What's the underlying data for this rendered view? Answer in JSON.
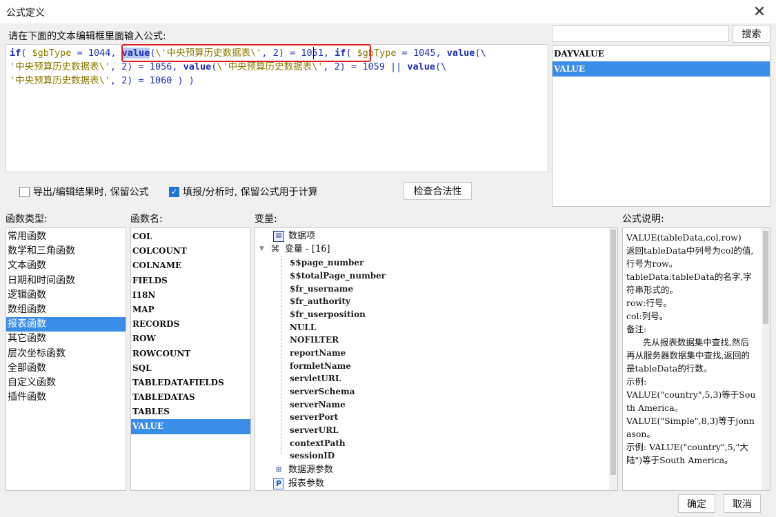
{
  "window": {
    "title": "公式定义",
    "close_icon": "close-icon"
  },
  "editor": {
    "label": "请在下面的文本编辑框里面输入公式:",
    "line1": {
      "if1": "if",
      "p1": "( ",
      "var1": "$gbType",
      "op1": " = ",
      "n1": "1044",
      "p2": ", ",
      "fn1": "value",
      "p3": "(",
      "s1": "\\'中央预算历史数据表\\'",
      "p4": ", ",
      "n2": "2",
      "p5": ") = ",
      "n3": "1051",
      "p6": ", ",
      "if2": "if",
      "p7": "( ",
      "var2": "$gbType",
      "op2": " = ",
      "n4": "1045",
      "p8": ", ",
      "fn2": "value",
      "p9": "(\\"
    },
    "line2": {
      "s2": "'中央预算历史数据表\\'",
      "p1": ", ",
      "n1": "2",
      "p2": ") = ",
      "n2": "1056",
      "p3": ", ",
      "fn1": "value",
      "p4": "(",
      "s3": "\\'中央预算历史数据表\\'",
      "p5": ", ",
      "n3": "2",
      "p6": ") = ",
      "n4": "1059",
      "p7": " || ",
      "fn2": "value",
      "p8": "(\\"
    },
    "line3": {
      "s4": "'中央预算历史数据表\\'",
      "p1": ", ",
      "n1": "2",
      "p2": ") = ",
      "n2": "1060",
      "p3": " ) )"
    }
  },
  "search": {
    "value": "",
    "button_label": "搜索"
  },
  "top_function_list": {
    "items": [
      "DAYVALUE",
      "VALUE"
    ],
    "selected": "VALUE"
  },
  "options": {
    "keep_formula_on_export": {
      "label": "导出/编辑结果时, 保留公式",
      "checked": false
    },
    "keep_formula_on_fill": {
      "label": "填报/分析时, 保留公式用于计算",
      "checked": true
    },
    "check_button_label": "检查合法性"
  },
  "function_types": {
    "label": "函数类型:",
    "items": [
      "常用函数",
      "数学和三角函数",
      "文本函数",
      "日期和时间函数",
      "逻辑函数",
      "数组函数",
      "报表函数",
      "其它函数",
      "层次坐标函数",
      "全部函数",
      "自定义函数",
      "插件函数"
    ],
    "selected": "报表函数"
  },
  "function_names": {
    "label": "函数名:",
    "items": [
      "COL",
      "COLCOUNT",
      "COLNAME",
      "FIELDS",
      "I18N",
      "MAP",
      "RECORDS",
      "ROW",
      "ROWCOUNT",
      "SQL",
      "TABLEDATAFIELDS",
      "TABLEDATAS",
      "TABLES",
      "VALUE"
    ],
    "selected": "VALUE"
  },
  "variables": {
    "label": "变量:",
    "data_item": "数据项",
    "var_group": "变量 - [16]",
    "var_items": [
      "$$page_number",
      "$$totalPage_number",
      "$fr_username",
      "$fr_authority",
      "$fr_userposition",
      "NULL",
      "NOFILTER",
      "reportName",
      "formletName",
      "servletURL",
      "serverSchema",
      "serverName",
      "serverPort",
      "serverURL",
      "contextPath",
      "sessionID"
    ],
    "datasource_params": "数据源参数",
    "report_params": "报表参数",
    "icons": {
      "data_item": "table-icon",
      "var_group": "variable-icon",
      "datasource": "datasource-param-icon",
      "report": "report-param-icon"
    }
  },
  "description": {
    "label": "公式说明:",
    "text": "VALUE(tableData,col,row)\n返回tableData中列号为col的值, 行号为row。\ntableData:tableData的名字,字符串形式的。\nrow:行号。\ncol:列号。\n备注:\n      先从报表数据集中查找,然后再从服务器数据集中查找,返回的是tableData的行数。\n示例:\nVALUE(\"country\",5,3)等于South America。\nVALUE(\"Simple\",8,3)等于jonnason。\n示例: VALUE(\"country\",5,\"大陆\")等于South America。"
  },
  "footer": {
    "ok_label": "确定",
    "cancel_label": "取消"
  }
}
